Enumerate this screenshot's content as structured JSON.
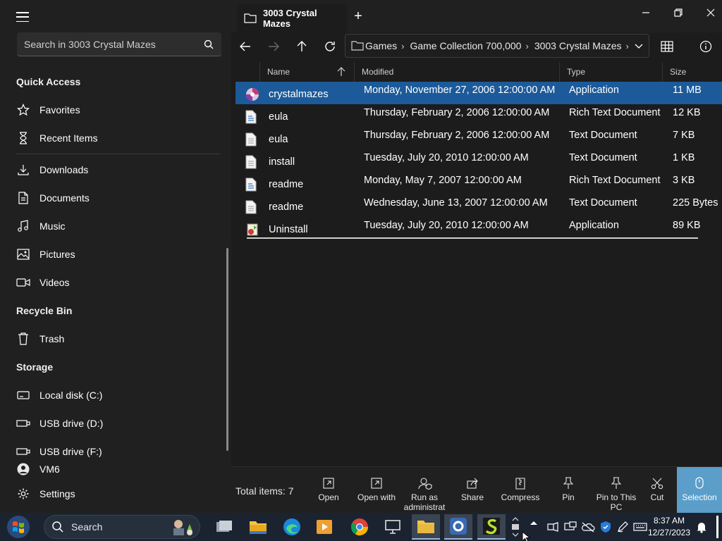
{
  "sidebar": {
    "search_placeholder": "Search in 3003 Crystal Mazes",
    "sections": {
      "quick_access": "Quick Access",
      "recycle_bin": "Recycle Bin",
      "storage": "Storage"
    },
    "quick_items": [
      {
        "label": "Favorites",
        "icon": "star-icon"
      },
      {
        "label": "Recent Items",
        "icon": "hourglass-icon"
      }
    ],
    "library_items": [
      {
        "label": "Downloads",
        "icon": "download-icon"
      },
      {
        "label": "Documents",
        "icon": "document-icon"
      },
      {
        "label": "Music",
        "icon": "music-note-icon"
      },
      {
        "label": "Pictures",
        "icon": "picture-icon"
      },
      {
        "label": "Videos",
        "icon": "video-icon"
      }
    ],
    "trash": {
      "label": "Trash",
      "icon": "trash-icon"
    },
    "drives": [
      {
        "label": "Local disk (C:)",
        "icon": "drive-icon"
      },
      {
        "label": "USB drive (D:)",
        "icon": "usb-drive-icon"
      },
      {
        "label": "USB drive (F:)",
        "icon": "usb-drive-icon"
      }
    ],
    "user": "VM6",
    "settings": "Settings"
  },
  "tab": {
    "title": "3003 Crystal Mazes"
  },
  "address": {
    "crumbs": [
      "Games",
      "Game Collection 700,000",
      "3003 Crystal Mazes"
    ],
    "sep": "›"
  },
  "columns": {
    "name": "Name",
    "modified": "Modified",
    "type": "Type",
    "size": "Size"
  },
  "files": [
    {
      "name": "crystalmazes",
      "modified": "Monday, November 27, 2006 12:00:00 AM",
      "type": "Application",
      "size": "11 MB",
      "icon": "application-icon",
      "selected": true
    },
    {
      "name": "eula",
      "modified": "Thursday, February 2, 2006 12:00:00 AM",
      "type": "Rich Text Document",
      "size": "12 KB",
      "icon": "rtf-file-icon"
    },
    {
      "name": "eula",
      "modified": "Thursday, February 2, 2006 12:00:00 AM",
      "type": "Text Document",
      "size": "7 KB",
      "icon": "text-file-icon"
    },
    {
      "name": "install",
      "modified": "Tuesday, July 20, 2010 12:00:00 AM",
      "type": "Text Document",
      "size": "1 KB",
      "icon": "text-file-icon"
    },
    {
      "name": "readme",
      "modified": "Monday, May 7, 2007 12:00:00 AM",
      "type": "Rich Text Document",
      "size": "3 KB",
      "icon": "rtf-file-icon"
    },
    {
      "name": "readme",
      "modified": "Wednesday, June 13, 2007 12:00:00 AM",
      "type": "Text Document",
      "size": "225 Bytes",
      "icon": "text-file-icon"
    },
    {
      "name": "Uninstall",
      "modified": "Tuesday, July 20, 2010 12:00:00 AM",
      "type": "Application",
      "size": "89 KB",
      "icon": "uninstall-icon"
    }
  ],
  "status": {
    "total": "Total items: 7"
  },
  "commands": [
    {
      "label": "Open",
      "icon": "open-icon"
    },
    {
      "label": "Open with",
      "icon": "open-with-icon"
    },
    {
      "label": "Run as administrat",
      "icon": "run-as-admin-icon"
    },
    {
      "label": "Share",
      "icon": "share-icon"
    },
    {
      "label": "Compress",
      "icon": "compress-icon"
    },
    {
      "label": "Pin",
      "icon": "pin-icon"
    },
    {
      "label": "Pin to This PC",
      "icon": "pin-to-pc-icon"
    },
    {
      "label": "Cut",
      "icon": "cut-icon"
    },
    {
      "label": "Selection",
      "icon": "selection-icon"
    }
  ],
  "taskbar": {
    "search_label": "Search",
    "time": "8:37 AM",
    "date": "12/27/2023"
  },
  "colors": {
    "selected_row": "#1c5a9a",
    "selection_button": "#5a9ec9",
    "taskbar": "#1b2330"
  }
}
